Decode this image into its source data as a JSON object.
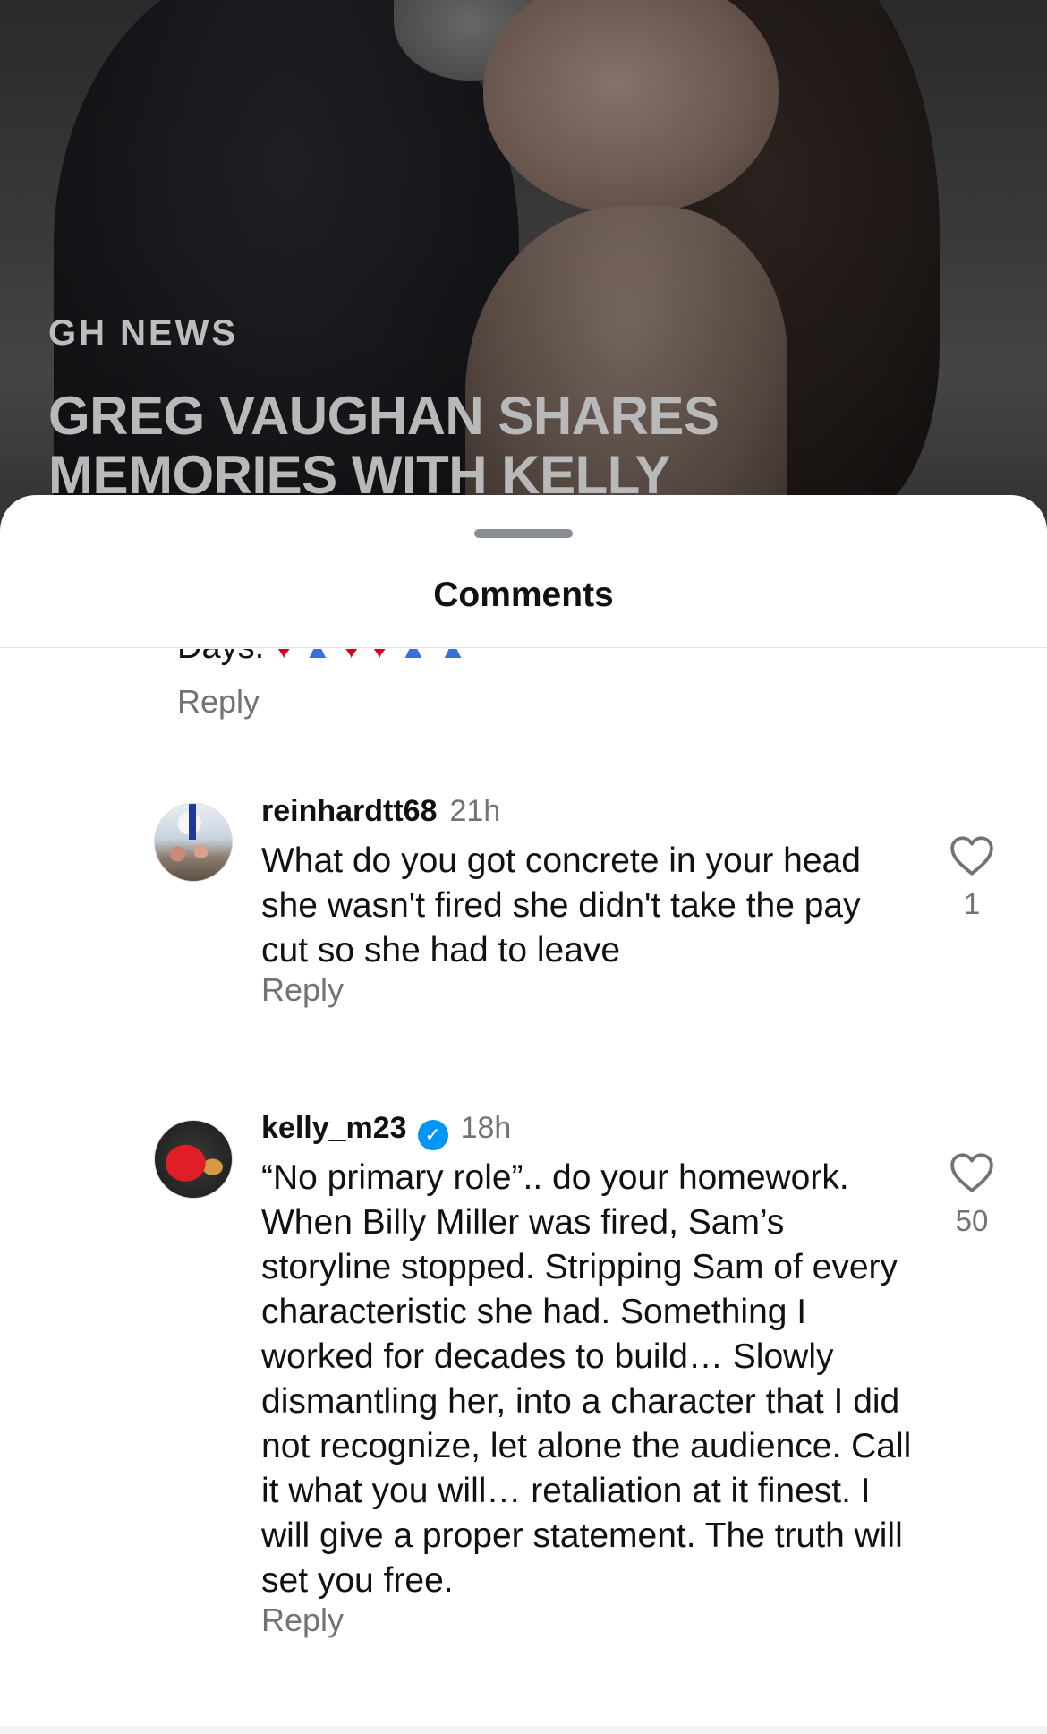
{
  "post": {
    "category": "GH NEWS",
    "headline": "GREG VAUGHAN SHARES MEMORIES WITH KELLY"
  },
  "sheet": {
    "title": "Comments",
    "previous_comment_tail": "Days.",
    "previous_emojis": [
      "heart",
      "hands",
      "heart",
      "heart",
      "hands",
      "hands"
    ]
  },
  "comments": [
    {
      "username": "reinhardtt68",
      "time": "21h",
      "verified": false,
      "text": "What do you got concrete in your head she wasn't fired she didn't take the pay cut so she had to leave",
      "likes": "1",
      "reply_label": "Reply"
    },
    {
      "username": "kelly_m23",
      "time": "18h",
      "verified": true,
      "text": "“No primary role”.. do your homework. When Billy Miller was fired, Sam’s storyline stopped. Stripping Sam of every characteristic she had. Something I worked for decades to build… Slowly dismantling her, into a character that I did not recognize, let alone the audience. Call it what you will… retaliation at it finest. I will give a proper statement. The truth will set you free.",
      "likes": "50",
      "reply_label": "Reply"
    }
  ],
  "labels": {
    "reply": "Reply"
  },
  "colors": {
    "secondary_text": "#737373",
    "primary_text": "#111111",
    "verified_blue": "#0095f6"
  }
}
